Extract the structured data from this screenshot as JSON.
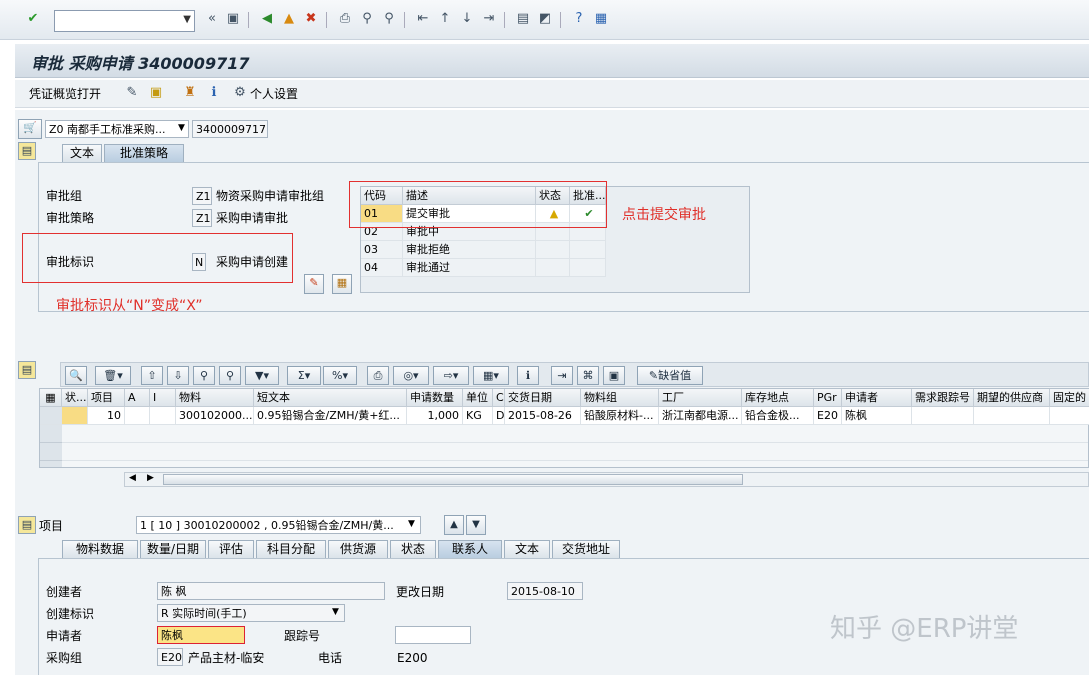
{
  "toolbar": {
    "command_value": "",
    "icons": [
      "enter-icon",
      "save-icon",
      "back-icon",
      "exit-icon",
      "cancel-icon",
      "print-icon",
      "find-icon",
      "find-next-icon",
      "first-page-icon",
      "prev-page-icon",
      "next-page-icon",
      "last-page-icon",
      "new-session-icon",
      "shortcut-icon",
      "help-icon",
      "customize-icon"
    ]
  },
  "title": "审批 采购申请 3400009717",
  "app_toolbar": {
    "doc_overview": "凭证概览打开",
    "personal_settings": "个人设置"
  },
  "header": {
    "doc_type": "Z0 南都手工标准采购...",
    "doc_number": "3400009717"
  },
  "tabs_top": [
    "文本",
    "批准策略"
  ],
  "approval": {
    "group_label": "审批组",
    "group_code": "Z1",
    "group_text": "物资采购申请审批组",
    "strategy_label": "审批策略",
    "strategy_code": "Z1",
    "strategy_text": "采购申请审批",
    "indicator_label": "审批标识",
    "indicator_code": "N",
    "indicator_text": "采购申请创建",
    "table_headers": [
      "代码",
      "描述",
      "状态",
      "批准..."
    ],
    "table_rows": [
      [
        "01",
        "提交审批"
      ],
      [
        "02",
        "审批中"
      ],
      [
        "03",
        "审批拒绝"
      ],
      [
        "04",
        "审批通过"
      ]
    ]
  },
  "annotations": {
    "click_submit": "点击提交审批",
    "flag_change": "审批标识从“N”变成“X”"
  },
  "item_grid": {
    "default_value_button": "缺省值",
    "headers": [
      "状...",
      "项目",
      "A",
      "I",
      "物料",
      "短文本",
      "申请数量",
      "单位",
      "C",
      "交货日期",
      "物料组",
      "工厂",
      "库存地点",
      "PGr",
      "申请者",
      "需求跟踪号",
      "期望的供应商",
      "固定的"
    ],
    "rows": [
      [
        "",
        "10",
        "",
        "",
        "300102000...",
        "0.95铅锡合金/ZMH/黄+红...",
        "1,000",
        "KG",
        "D",
        "2015-08-26",
        "铅酸原材料-...",
        "浙江南都电源...",
        "铅合金极...",
        "E20",
        "陈枫",
        "",
        "",
        ""
      ]
    ]
  },
  "item_section": {
    "label": "项目",
    "selector": "1 [ 10 ] 30010200002 , 0.95铅锡合金/ZMH/黄..."
  },
  "tabs_item": [
    "物料数据",
    "数量/日期",
    "评估",
    "科目分配",
    "供货源",
    "状态",
    "联系人",
    "文本",
    "交货地址"
  ],
  "contact": {
    "creator_label": "创建者",
    "creator": "陈 枫",
    "change_date_label": "更改日期",
    "change_date": "2015-08-10",
    "create_flag_label": "创建标识",
    "create_flag": "R 实际时间(手工)",
    "requester_label": "申请者",
    "requester": "陈枫",
    "tracking_label": "跟踪号",
    "tracking": "",
    "purch_group_label": "采购组",
    "purch_group_code": "E20",
    "purch_group_text": "产品主材-临安",
    "phone_label": "电话",
    "phone": "E200"
  },
  "watermark": "知乎 @ERP讲堂"
}
